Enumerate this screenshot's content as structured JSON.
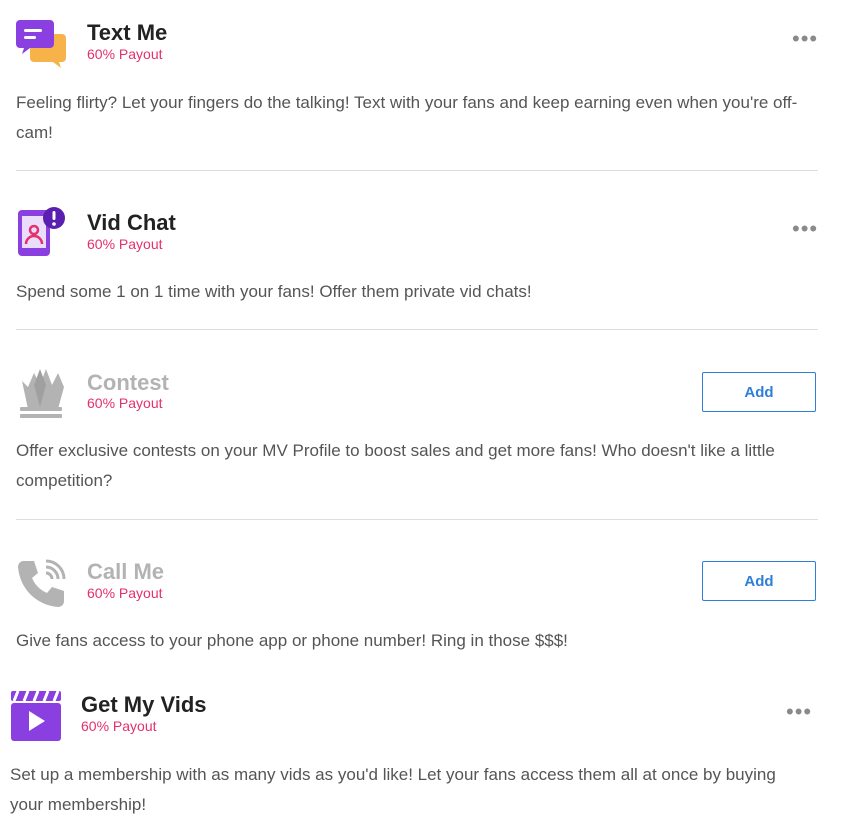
{
  "items": [
    {
      "title": "Text Me",
      "payout": "60% Payout",
      "description": "Feeling flirty? Let your fingers do the talking! Text with your fans and keep earning even when you're off-cam!",
      "action": "more",
      "more_label": "•••",
      "icon": "chat-bubbles-icon"
    },
    {
      "title": "Vid Chat",
      "payout": "60% Payout",
      "description": "Spend some 1 on 1 time with your fans! Offer them private vid chats!",
      "action": "more",
      "more_label": "•••",
      "icon": "phone-video-alert-icon"
    },
    {
      "title": "Contest",
      "payout": "60% Payout",
      "description": "Offer exclusive contests on your MV Profile to boost sales and get more fans! Who doesn't like a little competition?",
      "action": "add",
      "add_label": "Add",
      "icon": "crown-icon"
    },
    {
      "title": "Call Me",
      "payout": "60% Payout",
      "description": "Give fans access to your phone app or phone number! Ring in those $$$!",
      "action": "add",
      "add_label": "Add",
      "icon": "phone-call-icon"
    },
    {
      "title": "Get My Vids",
      "payout": "60% Payout",
      "description": "Set up a membership with as many vids as you'd like! Let your fans access them all at once by buying your membership!",
      "action": "more",
      "more_label": "•••",
      "icon": "clapperboard-play-icon"
    }
  ],
  "colors": {
    "payout": "#e4306c",
    "accent_purple": "#8a3fe0",
    "button_blue": "#2f7fd8",
    "disabled_gray": "#b3b3b3"
  }
}
